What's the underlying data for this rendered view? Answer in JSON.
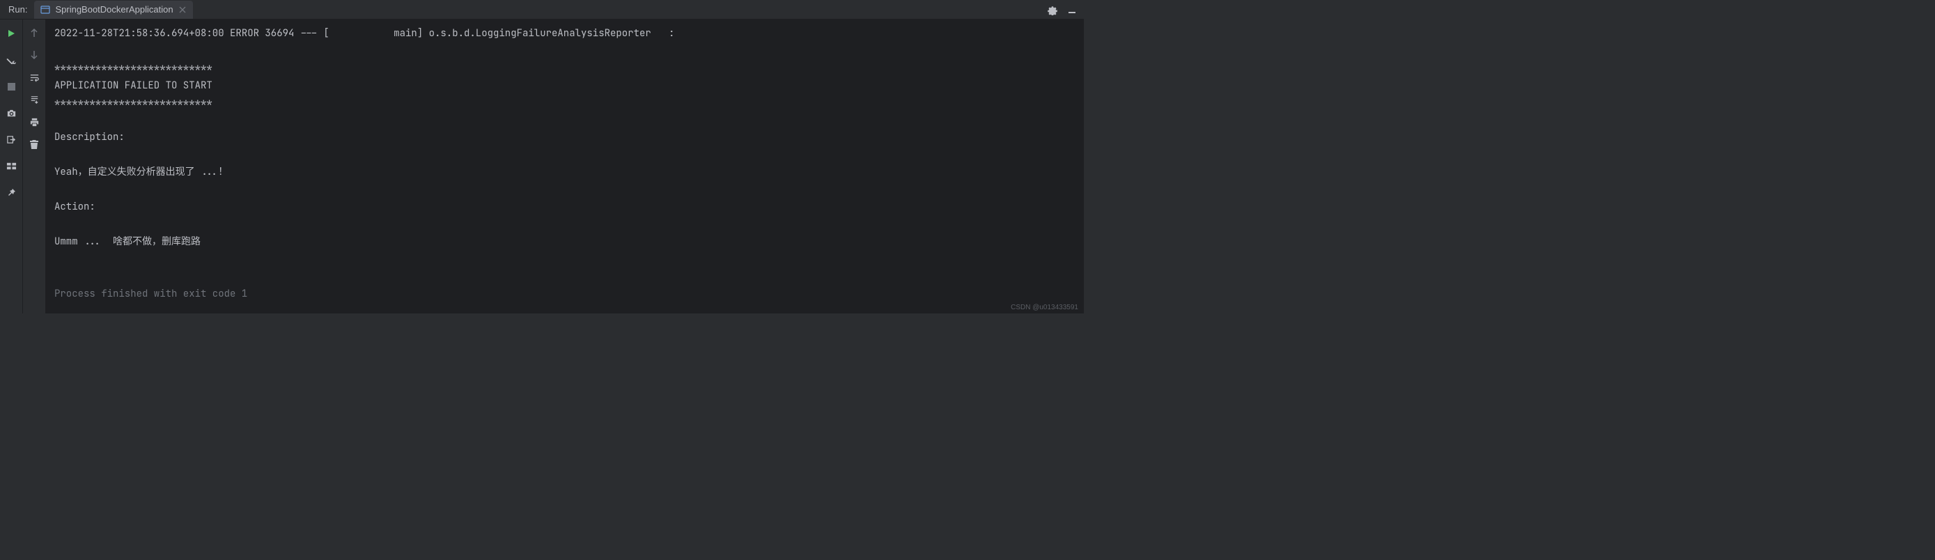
{
  "tabBar": {
    "label": "Run:",
    "tab": {
      "name": "SpringBootDockerApplication"
    }
  },
  "console": {
    "line1": "2022-11-28T21:58:36.694+08:00 ERROR 36694 --- [           main] o.s.b.d.LoggingFailureAnalysisReporter   :",
    "line2": "",
    "line3": "***************************",
    "line4": "APPLICATION FAILED TO START",
    "line5": "***************************",
    "line6": "",
    "line7": "Description:",
    "line8": "",
    "line9": "Yeah，自定义失败分析器出现了 ...！",
    "line10": "",
    "line11": "Action:",
    "line12": "",
    "line13": "Ummm ...  啥都不做，删库跑路",
    "line14": "",
    "line15": "",
    "exitLine": "Process finished with exit code 1"
  },
  "watermark": "CSDN @u013433591"
}
